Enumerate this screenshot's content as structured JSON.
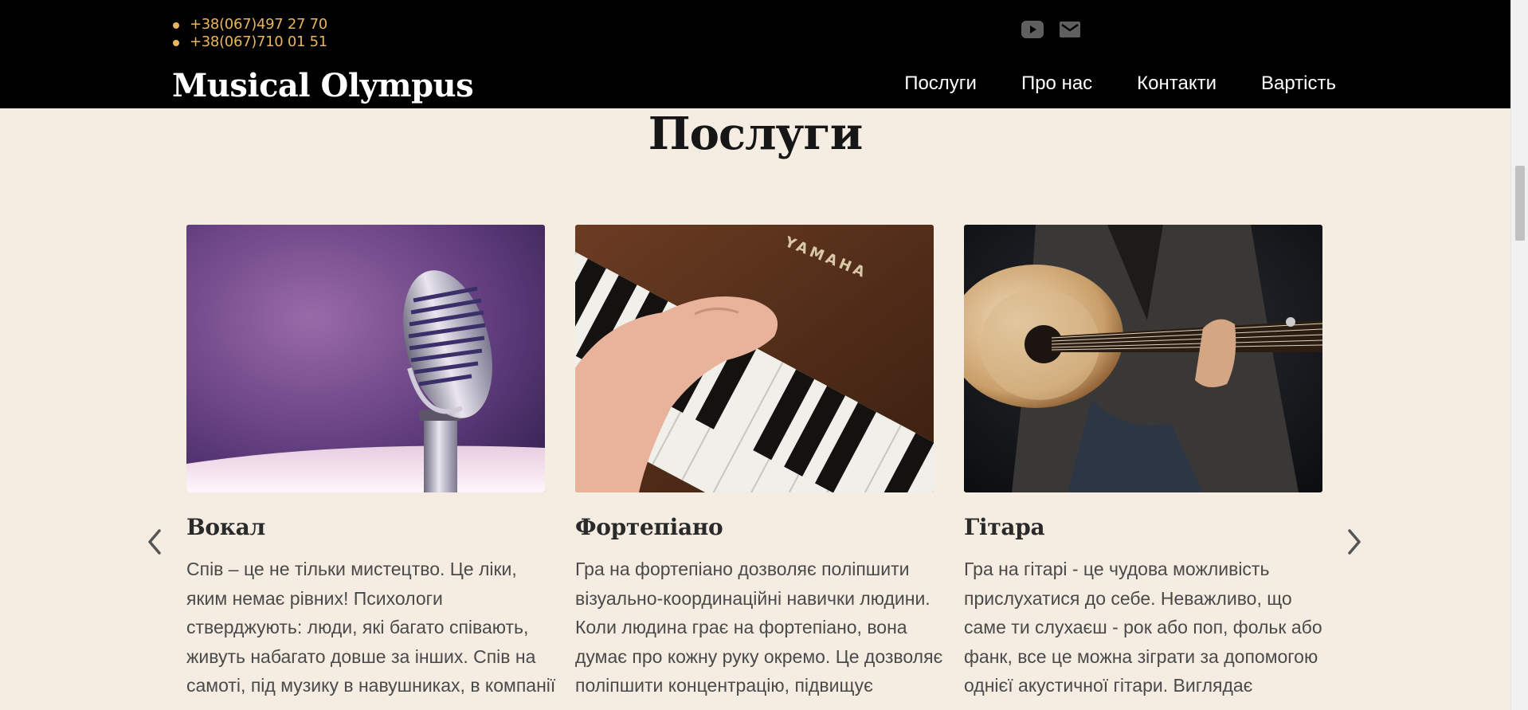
{
  "header": {
    "phones": [
      "+38(067)497 27 70",
      "+38(067)710 01 51"
    ],
    "brand": "Musical Olympus",
    "social_icons": [
      "youtube-icon",
      "email-icon"
    ],
    "nav": [
      "Послуги",
      "Про нас",
      "Контакти",
      "Вартість"
    ],
    "accent_color": "#e8b55a"
  },
  "section": {
    "title": "Послуги",
    "prev_icon": "chevron-left-icon",
    "next_icon": "chevron-right-icon",
    "cards": [
      {
        "image": "microphone-image",
        "title": "Вокал",
        "text": "Спів – це не тільки мистецтво. Це ліки, яким немає рівних! Психологи стверджують: люди, які багато співають, живуть набагато довше за інших. Спів на самоті, під музику в навушниках, в компанії"
      },
      {
        "image": "piano-image",
        "title": "Фортепіано",
        "text": "Гра на фортепіано дозволяє поліпшити візуально-координаційні навички людини. Коли людина грає на фортепіано, вона думає про кожну руку окремо. Це дозволяє поліпшити концентрацію, підвищує"
      },
      {
        "image": "guitar-image",
        "title": "Гітара",
        "text": "Гра на гітарі - це чудова можливість прислухатися до себе. Неважливо, що саме ти слухаєш - рок або поп, фольк або фанк, все це можна зіграти за допомогою однієї акустичної гітари. Виглядає"
      }
    ]
  },
  "colors": {
    "page_background": "#f5ece2",
    "header_background": "#000000"
  }
}
